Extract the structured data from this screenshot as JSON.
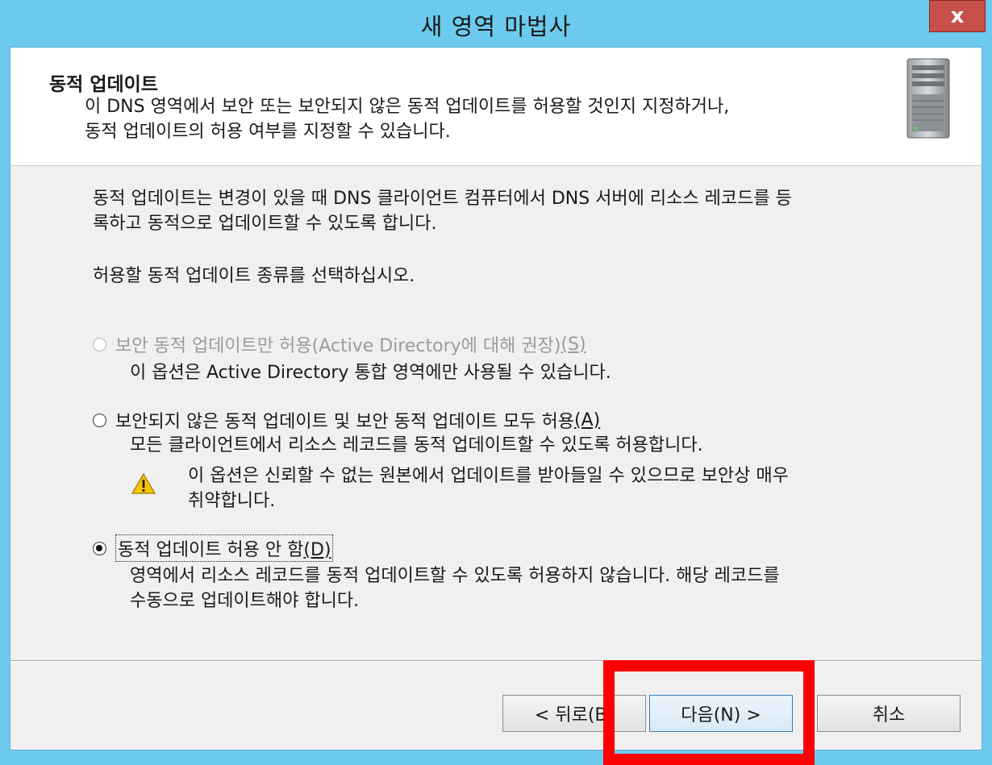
{
  "window": {
    "title": "새 영역 마법사",
    "close_glyph": "x"
  },
  "header": {
    "title": "동적 업데이트",
    "description_line1": "이 DNS 영역에서 보안 또는 보안되지 않은 동적 업데이트를 허용할 것인지 지정하거나,",
    "description_line2": "동적 업데이트의 허용 여부를 지정할 수 있습니다.",
    "icon": "server-icon"
  },
  "body": {
    "intro_line1": "동적 업데이트는 변경이 있을 때 DNS 클라이언트 컴퓨터에서 DNS 서버에 리소스 레코드를 등",
    "intro_line2": "록하고 동적으로 업데이트할 수 있도록 합니다.",
    "prompt": "허용할 동적 업데이트 종류를 선택하십시오."
  },
  "options": [
    {
      "label": "보안 동적 업데이트만 허용(Active Directory에 대해 권장)",
      "accel": "(S)",
      "description": "이 옵션은 Active Directory 통합 영역에만 사용될 수 있습니다.",
      "enabled": false,
      "selected": false
    },
    {
      "label": "보안되지 않은 동적 업데이트 및 보안 동적 업데이트 모두 허용",
      "accel": "(A)",
      "description": "모든 클라이언트에서 리소스 레코드를 동적 업데이트할 수 있도록 허용합니다.",
      "warning_line1": "이 옵션은 신뢰할 수 없는 원본에서 업데이트를 받아들일 수 있으므로 보안상 매우",
      "warning_line2": "취약합니다.",
      "enabled": true,
      "selected": false
    },
    {
      "label": "동적 업데이트 허용 안 함",
      "accel": "(D)",
      "description_line1": "영역에서 리소스 레코드를 동적 업데이트할 수 있도록 허용하지 않습니다. 해당 레코드를",
      "description_line2": "수동으로 업데이트해야 합니다.",
      "enabled": true,
      "selected": true
    }
  ],
  "buttons": {
    "back_label": "< 뒤로(B)",
    "next_label": "다음(N) >",
    "cancel_label": "취소"
  },
  "colors": {
    "frame": "#6ccaee",
    "close_button": "#c7504a",
    "highlight": "#ff0000",
    "warning": "#f5c400"
  }
}
